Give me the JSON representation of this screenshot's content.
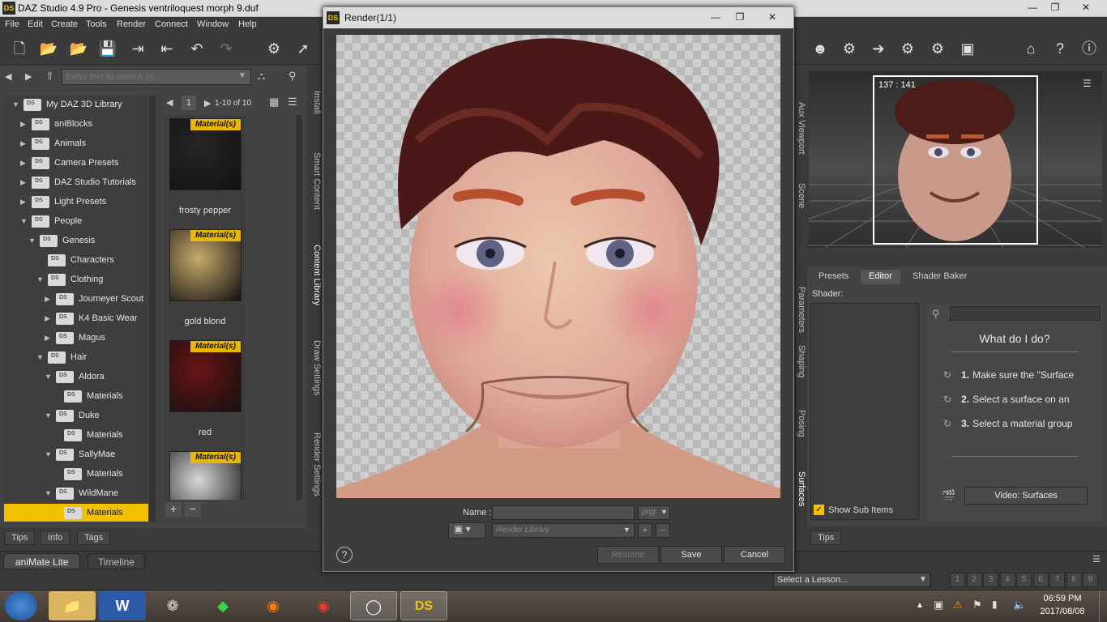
{
  "window": {
    "logo": "DS",
    "title": "DAZ Studio 4.9 Pro - Genesis ventriloquest morph 9.duf"
  },
  "menu": [
    "File",
    "Edit",
    "Create",
    "Tools",
    "Render",
    "Connect",
    "Window",
    "Help"
  ],
  "content_library": {
    "search_placeholder": "Enter text to search by...",
    "page_num": "1",
    "page_range": "1-10 of 10",
    "tree": [
      {
        "label": "My DAZ 3D Library",
        "indent": 0,
        "arrow": "down"
      },
      {
        "label": "aniBlocks",
        "indent": 1,
        "arrow": "right"
      },
      {
        "label": "Animals",
        "indent": 1,
        "arrow": "right"
      },
      {
        "label": "Camera Presets",
        "indent": 1,
        "arrow": "right"
      },
      {
        "label": "DAZ Studio Tutorials",
        "indent": 1,
        "arrow": "right"
      },
      {
        "label": "Light Presets",
        "indent": 1,
        "arrow": "right"
      },
      {
        "label": "People",
        "indent": 1,
        "arrow": "down"
      },
      {
        "label": "Genesis",
        "indent": 2,
        "arrow": "down"
      },
      {
        "label": "Characters",
        "indent": 3,
        "arrow": ""
      },
      {
        "label": "Clothing",
        "indent": 3,
        "arrow": "down"
      },
      {
        "label": "Journeyer Scout",
        "indent": 4,
        "arrow": "right"
      },
      {
        "label": "K4 Basic Wear",
        "indent": 4,
        "arrow": "right"
      },
      {
        "label": "Magus",
        "indent": 4,
        "arrow": "right"
      },
      {
        "label": "Hair",
        "indent": 3,
        "arrow": "down"
      },
      {
        "label": "Aldora",
        "indent": 4,
        "arrow": "down"
      },
      {
        "label": "Materials",
        "indent": 5,
        "arrow": ""
      },
      {
        "label": "Duke",
        "indent": 4,
        "arrow": "down"
      },
      {
        "label": "Materials",
        "indent": 5,
        "arrow": ""
      },
      {
        "label": "SallyMae",
        "indent": 4,
        "arrow": "down"
      },
      {
        "label": "Materials",
        "indent": 5,
        "arrow": ""
      },
      {
        "label": "WildMane",
        "indent": 4,
        "arrow": "down"
      },
      {
        "label": "Materials",
        "indent": 5,
        "arrow": "",
        "selected": true
      }
    ],
    "thumbnails": [
      {
        "tag": "Material(s)",
        "label": "frosty pepper",
        "color": "#262626"
      },
      {
        "tag": "Material(s)",
        "label": "gold blond",
        "color": "#c9a96a"
      },
      {
        "tag": "Material(s)",
        "label": "red",
        "color": "#6a1414"
      },
      {
        "tag": "Material(s)",
        "label": "",
        "color": "#d8d8d8"
      }
    ]
  },
  "side_tabs_left": [
    "Install",
    "Smart Content",
    "Content Library",
    "Draw Settings",
    "Render Settings"
  ],
  "bottom_tabs_left": [
    "Tips",
    "Info",
    "Tags"
  ],
  "timeline_tabs": [
    "aniMate Lite",
    "Timeline"
  ],
  "render_dialog": {
    "logo": "DS",
    "title": "Render(1/1)",
    "name_label": "Name :",
    "name_value": "",
    "format": "png",
    "library_placeholder": "Render Library",
    "resume_label": "Resume",
    "save_label": "Save",
    "cancel_label": "Cancel"
  },
  "aux_viewport": {
    "readout": "137 : 141",
    "tabs": [
      "Aux Viewport",
      "Scene"
    ]
  },
  "surfaces_panel": {
    "tabs": [
      "Presets",
      "Editor",
      "Shader Baker"
    ],
    "active_tab": "Editor",
    "shader_label": "Shader:",
    "help_title": "What do I do?",
    "steps": [
      {
        "num": "1.",
        "text": "Make sure the \"Surface"
      },
      {
        "num": "2.",
        "text": "Select a surface on an"
      },
      {
        "num": "3.",
        "text": "Select a material group"
      }
    ],
    "show_sub_items": "Show Sub Items",
    "video_button": "Video: Surfaces",
    "side_tabs": [
      "Parameters",
      "Shaping",
      "Posing",
      "Surfaces"
    ],
    "tips_tab": "Tips"
  },
  "lesson": {
    "select_placeholder": "Select a Lesson...",
    "pages": [
      "1",
      "2",
      "3",
      "4",
      "5",
      "6",
      "7",
      "8",
      "9"
    ]
  },
  "taskbar": {
    "time": "06:59 PM",
    "date": "2017/08/08"
  }
}
